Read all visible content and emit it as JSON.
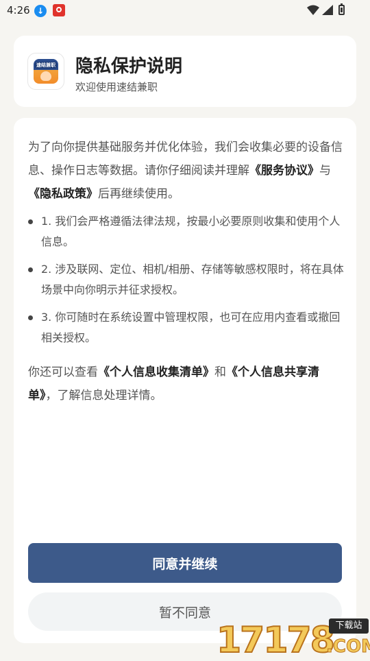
{
  "status_bar": {
    "time": "4:26",
    "icons": [
      "download-icon",
      "app-notification-icon",
      "wifi-icon",
      "signal-icon",
      "battery-icon"
    ]
  },
  "header": {
    "title": "隐私保护说明",
    "subtitle": "欢迎使用速结兼职",
    "logo_text": "速结兼职"
  },
  "content": {
    "intro_part1": "为了向你提供基础服务并优化体验，我们会收集必要的设备信息、操作日志等数据。请你仔细阅读并理解",
    "intro_link1": "《服务协议》",
    "intro_part2": "与",
    "intro_link2": "《隐私政策》",
    "intro_part3": "后再继续使用。",
    "bullets": [
      "1. 我们会严格遵循法律法规，按最小必要原则收集和使用个人信息。",
      "2. 涉及联网、定位、相机/相册、存储等敏感权限时，将在具体场景中向你明示并征求授权。",
      "3. 你可随时在系统设置中管理权限，也可在应用内查看或撤回相关授权。"
    ],
    "outro_part1": "你还可以查看",
    "outro_link1": "《个人信息收集清单》",
    "outro_part2": "和",
    "outro_link2": "《个人信息共享清单》",
    "outro_part3": "，了解信息处理详情。"
  },
  "actions": {
    "agree_label": "同意并继续",
    "disagree_label": "暂不同意"
  },
  "watermark": {
    "number": "17178",
    "tag": "下载站",
    "domain": ".COM"
  },
  "colors": {
    "background": "#f6f5f1",
    "primary_button": "#3d5a8a",
    "secondary_button": "#f2f4f5",
    "download_icon": "#1a8cf0"
  }
}
